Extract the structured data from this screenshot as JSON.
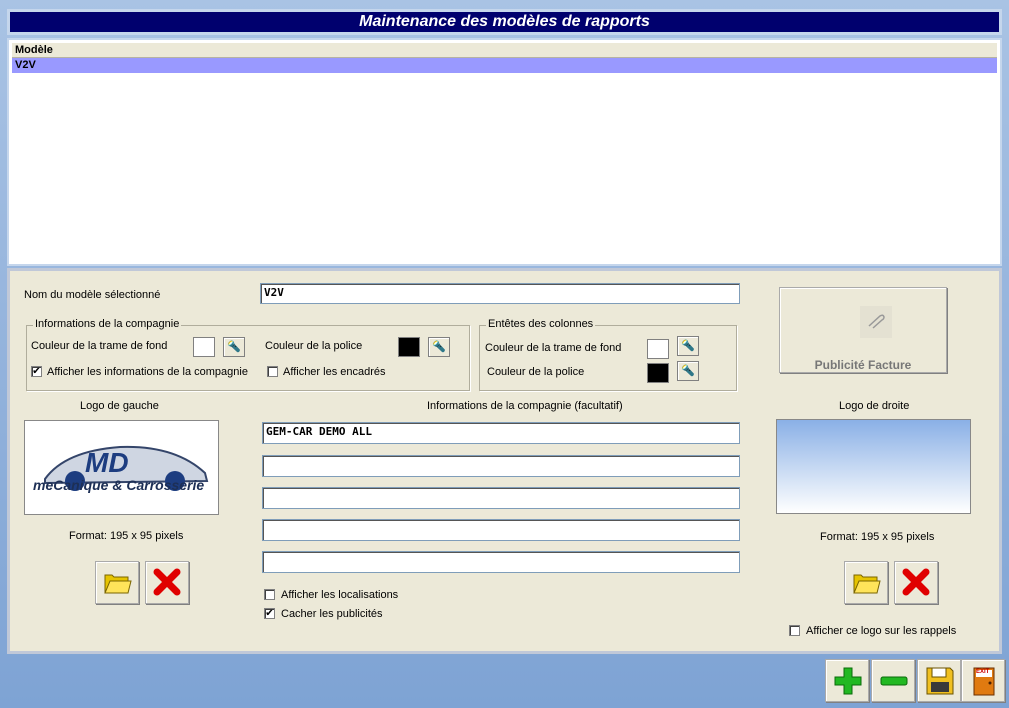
{
  "window": {
    "title": "Maintenance des modèles de rapports"
  },
  "list": {
    "column_header": "Modèle",
    "rows": [
      "V2V"
    ]
  },
  "form": {
    "model_name_label": "Nom du modèle sélectionné",
    "model_name_value": "V2V",
    "company_group": {
      "title": "Informations de la compagnie",
      "bg_color_label": "Couleur de la trame de fond",
      "font_color_label": "Couleur de la police",
      "show_info_label": "Afficher les informations de la compagnie",
      "show_info_checked": true,
      "show_frames_label": "Afficher les encadrés",
      "show_frames_checked": false,
      "bg_color": "#ffffff",
      "font_color": "#000000"
    },
    "columns_group": {
      "title": "Entêtes des colonnes",
      "bg_color_label": "Couleur de la trame de fond",
      "font_color_label": "Couleur de la police",
      "bg_color": "#ffffff",
      "font_color": "#000000"
    },
    "pub_button_label": "Publicité Facture",
    "left_logo": {
      "title": "Logo de gauche",
      "format": "Format: 195 x 95 pixels",
      "logo_big": "MD",
      "logo_small": "meCanique & Carrosserie"
    },
    "company_info": {
      "title": "Informations de la compagnie (facultatif)",
      "lines": [
        "GEM-CAR DEMO ALL",
        "",
        "",
        "",
        ""
      ]
    },
    "right_logo": {
      "title": "Logo de droite",
      "format": "Format: 195 x 95 pixels",
      "show_on_reminders_label": "Afficher ce logo sur les rappels",
      "show_on_reminders_checked": false
    },
    "show_locations_label": "Afficher les localisations",
    "show_locations_checked": false,
    "hide_ads_label": "Cacher les publicités",
    "hide_ads_checked": true
  },
  "toolbar": {
    "add_icon": "plus-icon",
    "remove_icon": "minus-icon",
    "save_icon": "floppy-icon",
    "exit_label": "EXIT"
  }
}
